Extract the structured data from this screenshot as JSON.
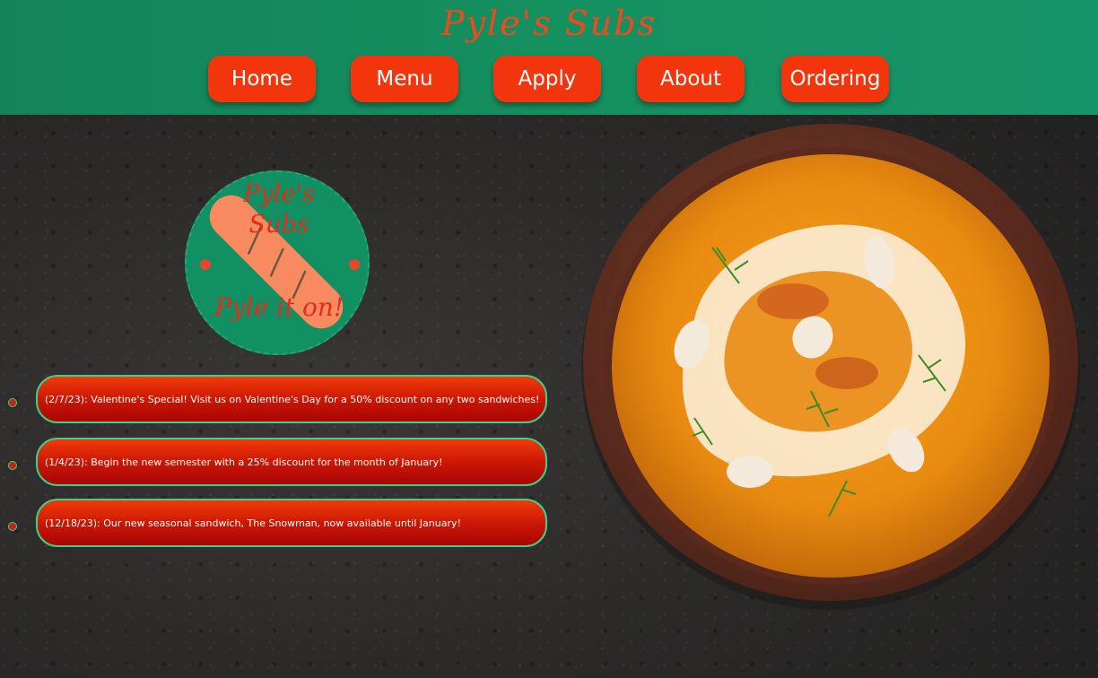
{
  "header": {
    "title": "Pyle's Subs"
  },
  "nav": {
    "items": [
      {
        "label": "Home"
      },
      {
        "label": "Menu"
      },
      {
        "label": "Apply"
      },
      {
        "label": "About"
      },
      {
        "label": "Ordering"
      }
    ]
  },
  "logo": {
    "line1": "Pyle's",
    "line2": "Subs",
    "tagline": "Pyle it on!"
  },
  "news": [
    {
      "text": "(2/7/23): Valentine's Special! Visit us on Valentine's Day for a 50% discount on any two sandwiches!"
    },
    {
      "text": "(1/4/23): Begin the new semester with a 25% discount for the month of January!"
    },
    {
      "text": "(12/18/23): Our new seasonal sandwich, The Snowman, now available until January!"
    }
  ],
  "colors": {
    "header_green": "#15905f",
    "accent_red": "#f2350d",
    "news_border": "#3fcf85"
  }
}
